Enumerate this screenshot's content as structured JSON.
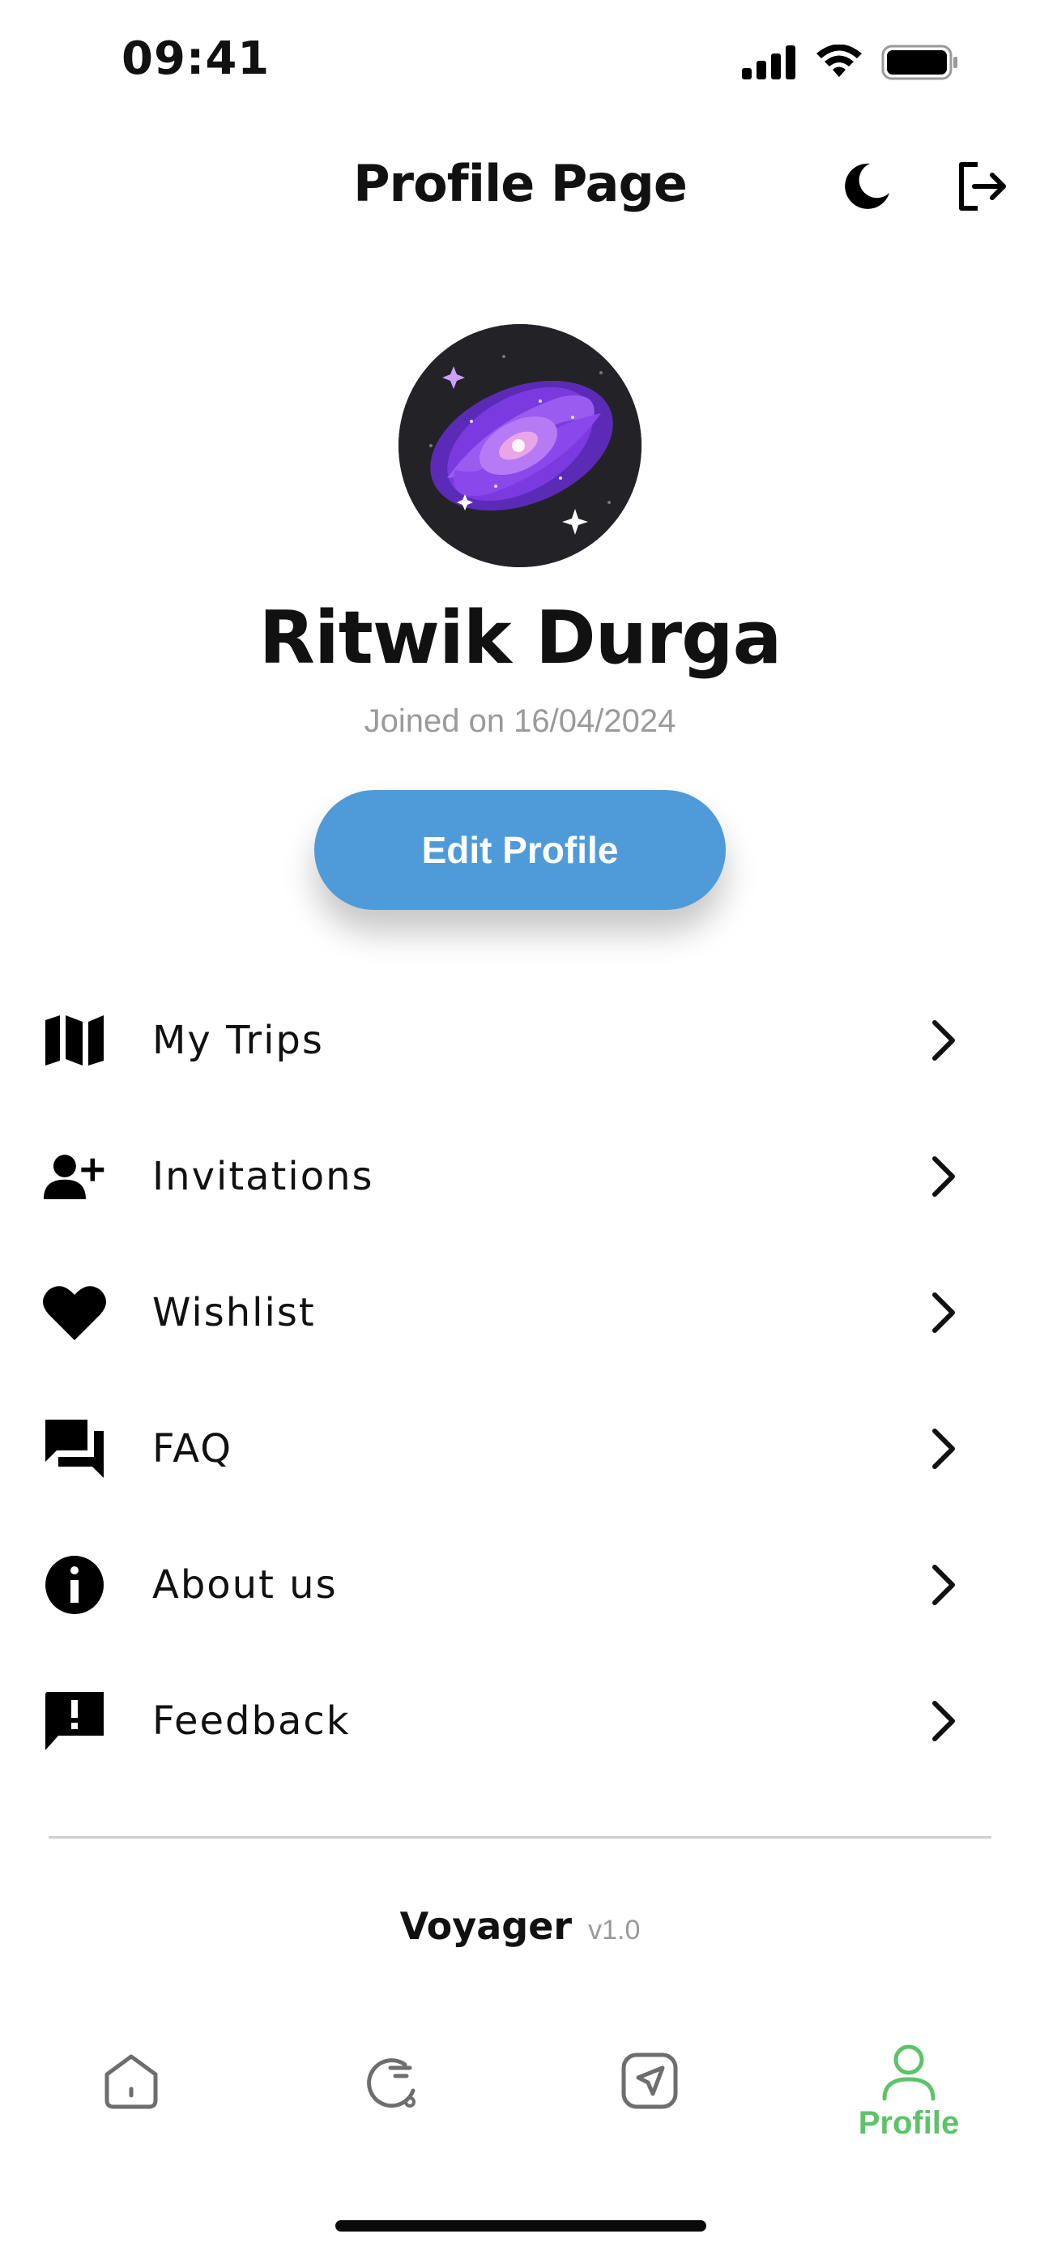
{
  "status": {
    "time": "09:41"
  },
  "header": {
    "title": "Profile Page",
    "theme_icon": "moon-icon",
    "logout_icon": "logout-icon"
  },
  "profile": {
    "name": "Ritwik Durga",
    "joined": "Joined on 16/04/2024",
    "edit_label": "Edit Profile"
  },
  "menu": {
    "items": [
      {
        "label": "My Trips",
        "icon": "map-icon"
      },
      {
        "label": "Invitations",
        "icon": "person-add-icon"
      },
      {
        "label": "Wishlist",
        "icon": "heart-icon"
      },
      {
        "label": "FAQ",
        "icon": "forum-icon"
      },
      {
        "label": "About us",
        "icon": "info-icon"
      },
      {
        "label": "Feedback",
        "icon": "feedback-icon"
      }
    ]
  },
  "footer": {
    "app_name": "Voyager",
    "version": "v1.0"
  },
  "tabbar": {
    "tabs": [
      {
        "icon": "home-icon",
        "label": ""
      },
      {
        "icon": "explore-icon",
        "label": ""
      },
      {
        "icon": "navigation-icon",
        "label": ""
      },
      {
        "icon": "profile-icon",
        "label": "Profile",
        "active": true
      }
    ]
  },
  "colors": {
    "accent": "#4f9bd9",
    "active_tab": "#5cc36a",
    "muted_text": "#9a9a9a"
  }
}
